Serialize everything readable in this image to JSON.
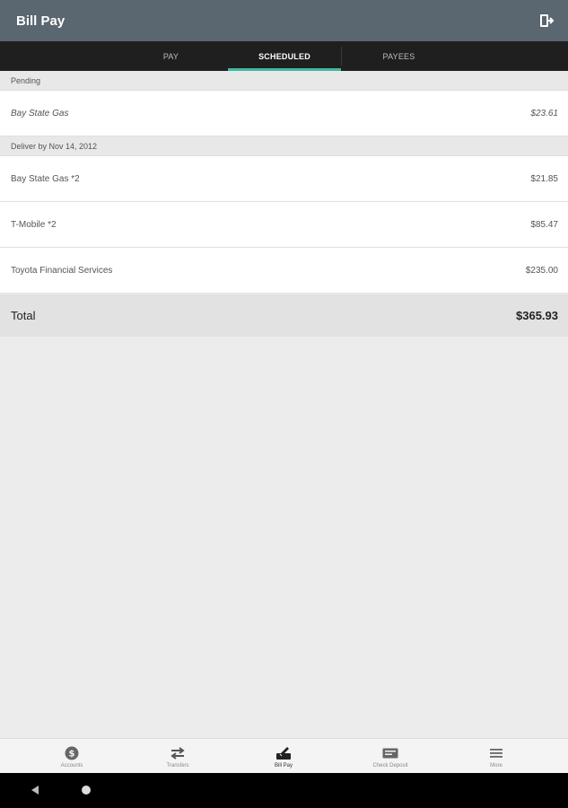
{
  "app_bar": {
    "title": "Bill Pay",
    "logout_icon": "logout-icon"
  },
  "tabs": [
    {
      "label": "PAY",
      "active": false
    },
    {
      "label": "SCHEDULED",
      "active": true
    },
    {
      "label": "PAYEES",
      "active": false
    }
  ],
  "sections": [
    {
      "header": "Pending",
      "items": [
        {
          "name": "Bay State Gas",
          "amount": "$23.61"
        }
      ]
    },
    {
      "header": "Deliver by Nov 14, 2012",
      "items": [
        {
          "name": "Bay State Gas *2",
          "amount": "$21.85"
        },
        {
          "name": "T-Mobile *2",
          "amount": "$85.47"
        },
        {
          "name": "Toyota Financial Services",
          "amount": "$235.00"
        }
      ]
    }
  ],
  "total": {
    "label": "Total",
    "amount": "$365.93"
  },
  "bottom_nav": [
    {
      "label": "Accounts",
      "icon": "dollar-icon",
      "active": false
    },
    {
      "label": "Transfers",
      "icon": "transfer-arrows-icon",
      "active": false
    },
    {
      "label": "Bill Pay",
      "icon": "bill-pay-icon",
      "active": true
    },
    {
      "label": "Check Deposit",
      "icon": "check-deposit-icon",
      "active": false
    },
    {
      "label": "More",
      "icon": "menu-icon",
      "active": false
    }
  ],
  "system_bar": {
    "back_icon": "back-icon",
    "home_icon": "home-icon"
  },
  "colors": {
    "app_bar": "#5a6670",
    "tab_bar": "#1f1f1f",
    "accent": "#3fb8a0"
  }
}
